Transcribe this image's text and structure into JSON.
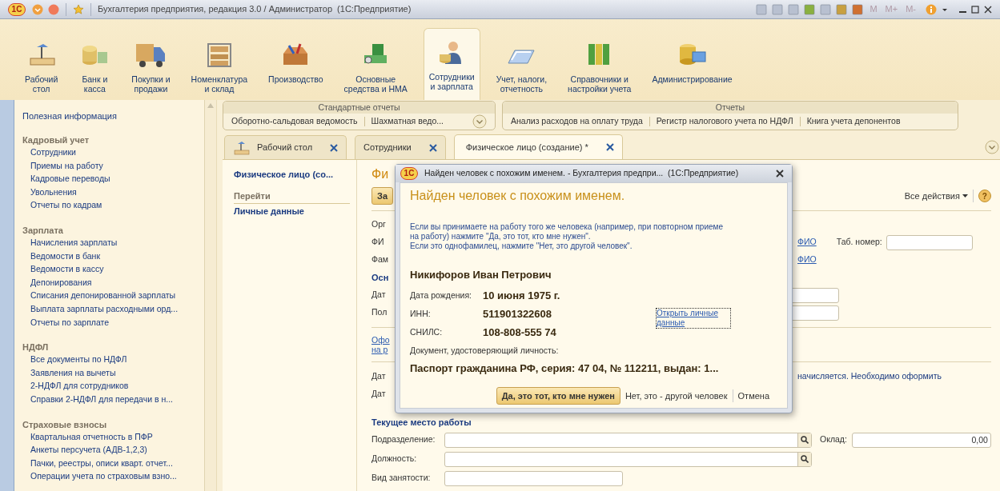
{
  "window": {
    "logo": "1С",
    "title": "Бухгалтерия предприятия, редакция 3.0 / Администратор  (1С:Предприятие)",
    "memory_buttons": [
      "M",
      "M+",
      "M-"
    ]
  },
  "sections": [
    {
      "label": "Рабочий\nстол",
      "selected": false
    },
    {
      "label": "Банк и\nкасса",
      "selected": false
    },
    {
      "label": "Покупки и\nпродажи",
      "selected": false
    },
    {
      "label": "Номенклатура\nи склад",
      "selected": false
    },
    {
      "label": "Производство",
      "selected": false
    },
    {
      "label": "Основные\nсредства и НМА",
      "selected": false
    },
    {
      "label": "Сотрудники\nи зарплата",
      "selected": true
    },
    {
      "label": "Учет, налоги,\nотчетность",
      "selected": false
    },
    {
      "label": "Справочники и\nнастройки учета",
      "selected": false
    },
    {
      "label": "Администрирование",
      "selected": false
    }
  ],
  "sidebar": {
    "top_link": "Полезная информация",
    "groups": [
      {
        "title": "Кадровый учет",
        "items": [
          "Сотрудники",
          "Приемы на работу",
          "Кадровые переводы",
          "Увольнения",
          "Отчеты по кадрам"
        ]
      },
      {
        "title": "Зарплата",
        "items": [
          "Начисления зарплаты",
          "Ведомости в банк",
          "Ведомости в кассу",
          "Депонирования",
          "Списания депонированной зарплаты",
          "Выплата зарплаты расходными орд...",
          "Отчеты по зарплате"
        ]
      },
      {
        "title": "НДФЛ",
        "items": [
          "Все документы по НДФЛ",
          "Заявления на вычеты",
          "2-НДФЛ для сотрудников",
          "Справки 2-НДФЛ для передачи в н..."
        ]
      },
      {
        "title": "Страховые взносы",
        "items": [
          "Квартальная отчетность в ПФР",
          "Анкеты персучета (АДВ-1,2,3)",
          "Пачки, реестры, описи кварт. отчет...",
          "Операции учета по страховым взно..."
        ]
      }
    ]
  },
  "command_groups": [
    {
      "title": "Стандартные отчеты",
      "items": [
        "Оборотно-сальдовая ведомость",
        "Шахматная ведо..."
      ],
      "has_more": true
    },
    {
      "title": "Отчеты",
      "items": [
        "Анализ расходов на оплату труда",
        "Регистр налогового учета по НДФЛ",
        "Книга учета депонентов"
      ],
      "has_more": false
    }
  ],
  "tabs": [
    {
      "label": "Рабочий стол",
      "selected": false,
      "has_icon": true
    },
    {
      "label": "Сотрудники",
      "selected": false,
      "has_icon": false
    },
    {
      "label": "Физическое лицо (создание) *",
      "selected": true,
      "has_icon": false
    }
  ],
  "navigation": {
    "title": "Физическое лицо (со...",
    "group": "Перейти",
    "items": [
      "Личные данные"
    ]
  },
  "form": {
    "title": "Фи",
    "write_button": "За",
    "all_actions": "Все действия",
    "help": "?",
    "rows": [
      {
        "kind": "label",
        "text": "Орг"
      },
      {
        "kind": "label",
        "text": "ФИ",
        "link": "ФИО",
        "side_label": "Таб. номер:"
      },
      {
        "kind": "label",
        "text": "Фам",
        "link": "ФИО"
      },
      {
        "kind": "heading",
        "text": "Осн"
      },
      {
        "kind": "input",
        "text": "Дат"
      },
      {
        "kind": "input",
        "text": "Пол"
      },
      {
        "kind": "divider"
      },
      {
        "kind": "link",
        "lines": [
          "Офо",
          "на р"
        ]
      },
      {
        "kind": "divider"
      },
      {
        "kind": "label",
        "text": "Дат",
        "note": "начисляется. Необходимо оформить"
      },
      {
        "kind": "label",
        "text": "Дат"
      }
    ],
    "work": {
      "title": "Текущее место работы",
      "fields": [
        {
          "label": "Подразделение:",
          "kind": "select",
          "side_label": "Оклад:",
          "side_value": "0,00"
        },
        {
          "label": "Должность:",
          "kind": "select"
        },
        {
          "label": "Вид занятости:",
          "kind": "input"
        }
      ]
    }
  },
  "dialog": {
    "logo": "1С",
    "title": "Найден человек с похожим именем. - Бухгалтерия предпри...  (1С:Предприятие)",
    "heading": "Найден человек с похожим именем.",
    "message": [
      "Если вы принимаете на работу того же человека (например, при повторном приеме",
      "на работу) нажмите \"Да, это тот, кто мне нужен\".",
      "Если это однофамилец, нажмите \"Нет, это другой человек\"."
    ],
    "person": "Никифоров Иван Петрович",
    "fields": [
      {
        "label": "Дата рождения:",
        "value": "10 июня 1975 г."
      },
      {
        "label": "ИНН:",
        "value": "511901322608"
      },
      {
        "label": "СНИЛС:",
        "value": "108-808-555 74"
      }
    ],
    "open_link": "Открыть личные данные",
    "document_label": "Документ, удостоверяющий личность:",
    "document": "Паспорт гражданина РФ, серия: 47 04, № 112211, выдан: 1...",
    "buttons": [
      {
        "label": "Да, это тот, кто мне нужен",
        "kind": "primary"
      },
      {
        "label": "Нет, это - другой человек",
        "kind": "flat"
      },
      {
        "label": "Отмена",
        "kind": "flat"
      }
    ]
  }
}
